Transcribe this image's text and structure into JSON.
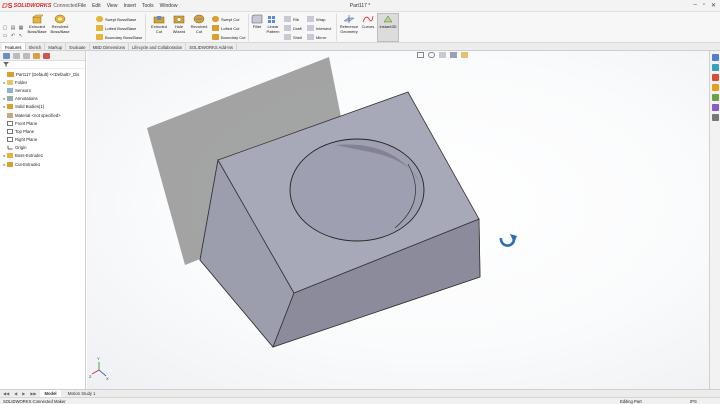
{
  "app": {
    "brand": "SOLIDWORKS",
    "edition": "Connected",
    "document_title": "Part117 *"
  },
  "menu": [
    "File",
    "Edit",
    "View",
    "Insert",
    "Tools",
    "Window"
  ],
  "ribbon": {
    "extruded_boss": "Extruded Boss/Base",
    "revolved_boss": "Revolved Boss/Base",
    "swept_boss": "Swept Boss/Base",
    "lofted_boss": "Lofted Boss/Base",
    "boundary_boss": "Boundary Boss/Base",
    "extruded_cut": "Extruded Cut",
    "hole_wizard": "Hole Wizard",
    "revolved_cut": "Revolved Cut",
    "swept_cut": "Swept Cut",
    "lofted_cut": "Lofted Cut",
    "boundary_cut": "Boundary Cut",
    "fillet": "Fillet",
    "linear_pattern": "Linear Pattern",
    "rib": "Rib",
    "draft": "Draft",
    "shell": "Shell",
    "wrap": "Wrap",
    "intersect": "Intersect",
    "mirror": "Mirror",
    "reference_geometry": "Reference Geometry",
    "curves": "Curves",
    "instant3d": "Instant3D"
  },
  "tabs": [
    "Features",
    "Sketch",
    "Markup",
    "Evaluate",
    "MBD Dimensions",
    "Lifecycle and Collaboration",
    "SOLIDWORKS Add-Ins"
  ],
  "feature_tree": [
    {
      "label": "Part117 (Default) <<Default>_Dis",
      "expander": "",
      "root": true
    },
    {
      "label": "Folder",
      "expander": "▸"
    },
    {
      "label": "Sensors",
      "expander": ""
    },
    {
      "label": "Annotations",
      "expander": "▸"
    },
    {
      "label": "Solid Bodies(1)",
      "expander": "▸"
    },
    {
      "label": "Material <not specified>",
      "expander": ""
    },
    {
      "label": "Front Plane",
      "expander": ""
    },
    {
      "label": "Top Plane",
      "expander": ""
    },
    {
      "label": "Right Plane",
      "expander": ""
    },
    {
      "label": "Origin",
      "expander": ""
    },
    {
      "label": "Boss-Extrude1",
      "expander": "▸"
    },
    {
      "label": "Cut-Extrude1",
      "expander": "▸"
    }
  ],
  "bottom_tabs": [
    "Model",
    "Motion Study 1"
  ],
  "status": {
    "left": "SOLIDWORKS Connected Maker",
    "mode": "Editing Part",
    "units": "IPS"
  },
  "colors": {
    "accent_red": "#d22222",
    "part_top": "#a9aab9",
    "part_front": "#8d8d9e",
    "part_side": "#9a9bac",
    "plane": "#8a8a8a"
  },
  "icons": {
    "rotate_cursor": "rotate-arrow-icon",
    "triad": "coordinate-triad-icon"
  }
}
